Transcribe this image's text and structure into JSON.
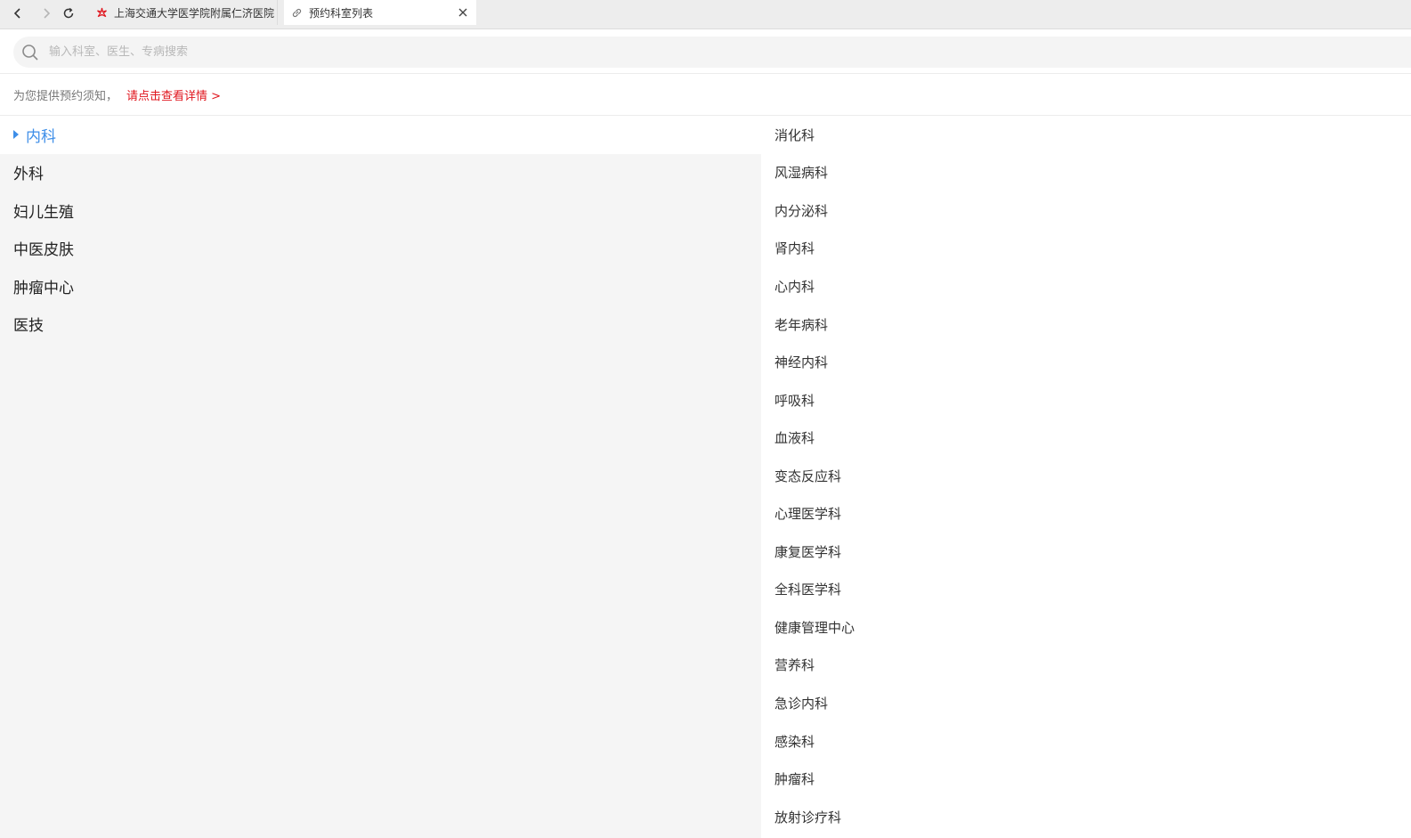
{
  "browser": {
    "tabs": [
      {
        "label": "上海交通大学医学院附属仁济医院",
        "icon": "hospital-logo-icon",
        "active": false
      },
      {
        "label": "预约科室列表",
        "icon": "link-icon",
        "active": true
      }
    ]
  },
  "search": {
    "placeholder": "输入科室、医生、专病搜索"
  },
  "notice": {
    "text": "为您提供预约须知，",
    "link": "请点击查看详情 >"
  },
  "categories": [
    {
      "label": "内科",
      "active": true
    },
    {
      "label": "外科",
      "active": false
    },
    {
      "label": "妇儿生殖",
      "active": false
    },
    {
      "label": "中医皮肤",
      "active": false
    },
    {
      "label": "肿瘤中心",
      "active": false
    },
    {
      "label": "医技",
      "active": false
    }
  ],
  "departments": [
    "消化科",
    "风湿病科",
    "内分泌科",
    "肾内科",
    "心内科",
    "老年病科",
    "神经内科",
    "呼吸科",
    "血液科",
    "变态反应科",
    "心理医学科",
    "康复医学科",
    "全科医学科",
    "健康管理中心",
    "营养科",
    "急诊内科",
    "感染科",
    "肿瘤科",
    "放射诊疗科"
  ],
  "colors": {
    "accent": "#3d8ee8",
    "link": "#e0161e",
    "sidebar_bg": "#f5f5f5"
  }
}
